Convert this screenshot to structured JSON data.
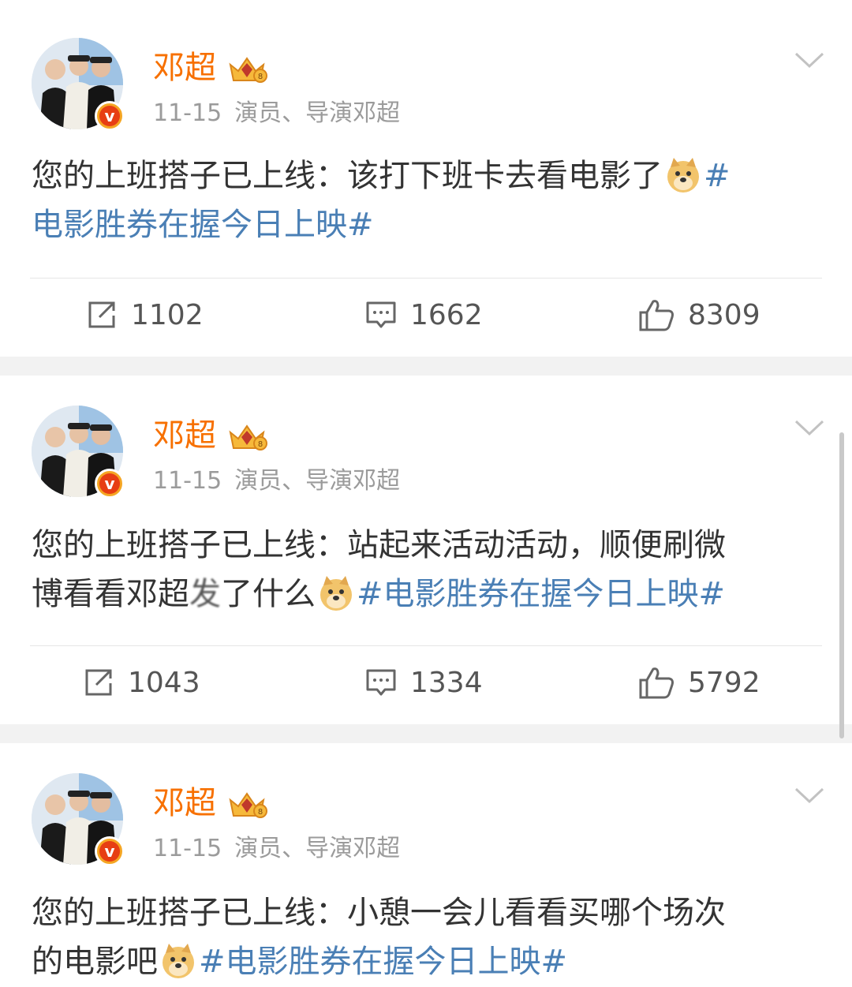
{
  "posts": [
    {
      "author": "邓超",
      "time": "11-15",
      "source": "演员、导演邓超",
      "text_before": "您的上班搭子已上线：该打下班卡去看电影了",
      "text_blur": "",
      "text_after": "",
      "topic_line1": "#",
      "topic_line2": "电影胜券在握今日上映#",
      "reposts": "1102",
      "comments": "1662",
      "likes": "8309"
    },
    {
      "author": "邓超",
      "time": "11-15",
      "source": "演员、导演邓超",
      "text_line1": "您的上班搭子已上线：站起来活动活动，顺便刷微",
      "text_line2_a": "博看看邓超",
      "text_blur": "发",
      "text_line2_b": "了什么",
      "topic": "#电影胜券在握今日上映#",
      "reposts": "1043",
      "comments": "1334",
      "likes": "5792"
    },
    {
      "author": "邓超",
      "time": "11-15",
      "source": "演员、导演邓超",
      "text_line1": "您的上班搭子已上线：小憩一会儿看看买哪个场次",
      "text_line2": "的电影吧",
      "topic": "#电影胜券在握今日上映#"
    }
  ],
  "icons": {
    "repost": "repost-icon",
    "comment": "comment-icon",
    "like": "like-icon",
    "verified": "verified-badge-icon",
    "crown": "crown-icon",
    "emoji": "doge-emoji-icon",
    "more": "chevron-down-icon"
  },
  "colors": {
    "author": "#f77000",
    "topic": "#4a7fb5",
    "meta": "#9b9b9b",
    "separator": "#f2f2f2"
  }
}
